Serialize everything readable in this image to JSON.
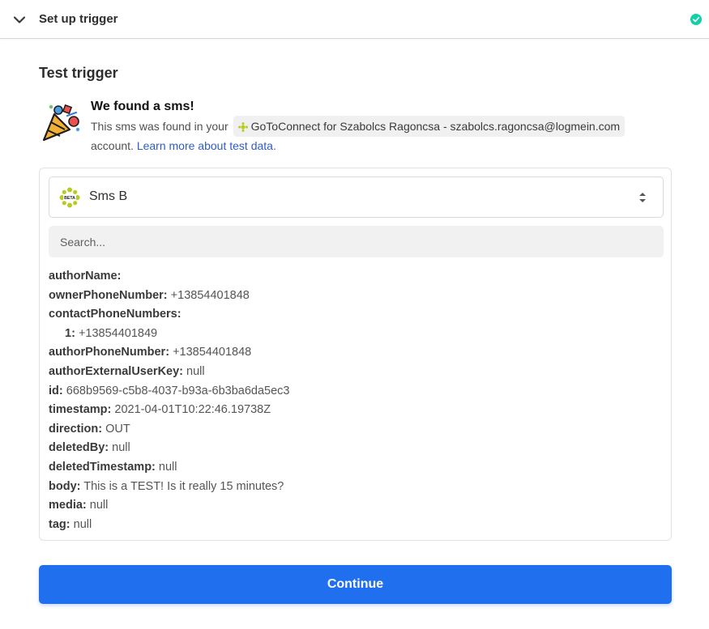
{
  "header": {
    "title": "Set up trigger",
    "status_color": "#13d0ab"
  },
  "section": {
    "title": "Test trigger"
  },
  "found": {
    "title": "We found a sms!",
    "prefix": "This sms was found in your",
    "account": "GoToConnect for Szabolcs Ragoncsa - szabolcs.ragoncsa@logmein.com",
    "suffix": "account.",
    "learn_more": "Learn more about test data."
  },
  "record_select": {
    "label": "Sms B",
    "icon": "goto-beta-icon"
  },
  "search": {
    "placeholder": "Search..."
  },
  "fields": {
    "authorName": {
      "key": "authorName:",
      "value": ""
    },
    "ownerPhoneNumber": {
      "key": "ownerPhoneNumber:",
      "value": "+13854401848"
    },
    "contactPhoneNumbers": {
      "key": "contactPhoneNumbers:",
      "value": ""
    },
    "contactPhoneNumbers_1": {
      "key": "1:",
      "value": "+13854401849"
    },
    "authorPhoneNumber": {
      "key": "authorPhoneNumber:",
      "value": "+13854401848"
    },
    "authorExternalUserKey": {
      "key": "authorExternalUserKey:",
      "value": "null"
    },
    "id": {
      "key": "id:",
      "value": "668b9569-c5b8-4037-b93a-6b3ba6da5ec3"
    },
    "timestamp": {
      "key": "timestamp:",
      "value": "2021-04-01T10:22:46.19738Z"
    },
    "direction": {
      "key": "direction:",
      "value": "OUT"
    },
    "deletedBy": {
      "key": "deletedBy:",
      "value": "null"
    },
    "deletedTimestamp": {
      "key": "deletedTimestamp:",
      "value": "null"
    },
    "body": {
      "key": "body:",
      "value": "This is a TEST! Is it really 15 minutes?"
    },
    "media": {
      "key": "media:",
      "value": "null"
    },
    "tag": {
      "key": "tag:",
      "value": "null"
    }
  },
  "continue_button": {
    "label": "Continue",
    "color": "#1f6fef"
  }
}
